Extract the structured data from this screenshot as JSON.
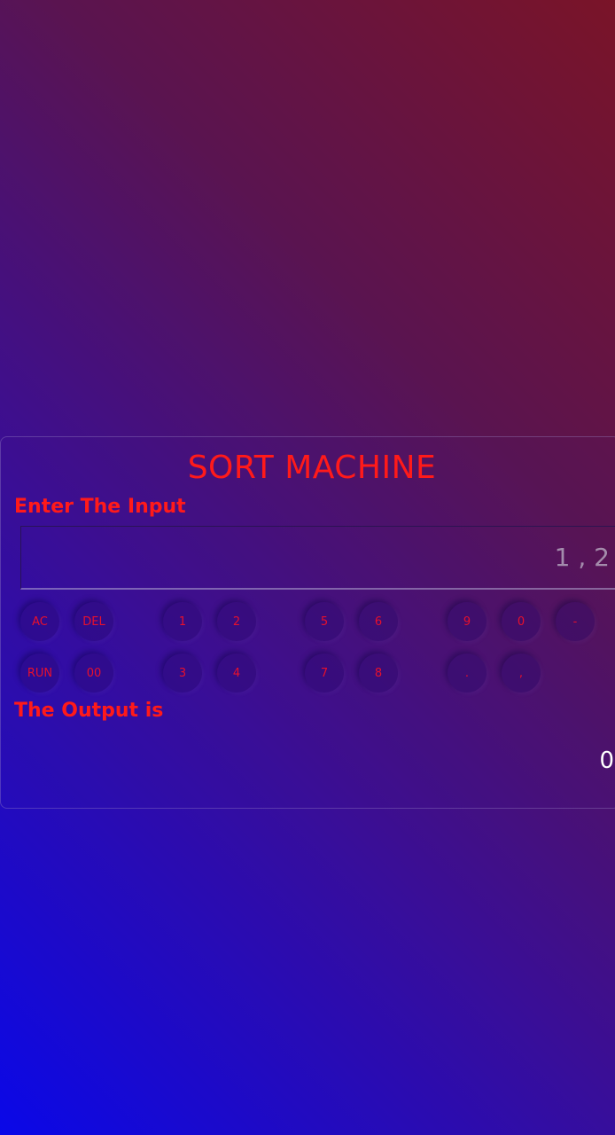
{
  "app": {
    "title": "SORT MACHINE"
  },
  "input": {
    "label": "Enter The Input",
    "value": "1 , 2"
  },
  "keypad": {
    "row1": [
      "AC",
      "DEL",
      "1",
      "2",
      "5",
      "6",
      "9",
      "0",
      "-"
    ],
    "row2": [
      "RUN",
      "00",
      "3",
      "4",
      "7",
      "8",
      ".",
      ","
    ]
  },
  "output": {
    "label": "The Output is",
    "value": "0"
  },
  "colors": {
    "accent": "#ff1a1a",
    "gradient_top_right": "#7a1428",
    "gradient_bottom_left": "#0a08e8"
  }
}
